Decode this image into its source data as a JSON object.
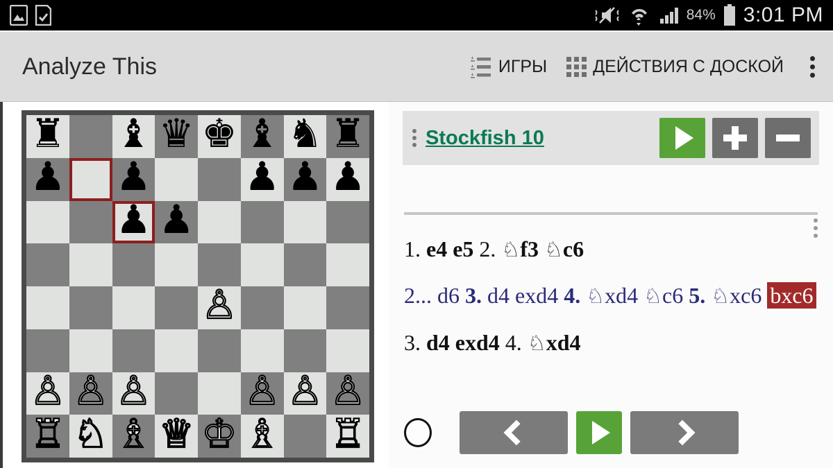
{
  "statusbar": {
    "icons": [
      "gallery-icon",
      "download-complete-icon",
      "mute-vibrate-icon",
      "wifi-icon",
      "cellular-signal-icon"
    ],
    "battery_percent": "84%",
    "battery_icon": "battery-icon",
    "clock": "3:01 PM"
  },
  "appbar": {
    "title": "Analyze This",
    "actions": [
      {
        "icon": "games-list-icon",
        "label": "ИГРЫ"
      },
      {
        "icon": "board-actions-grid-icon",
        "label": "ДЕЙСТВИЯ С ДОСКОЙ"
      }
    ],
    "overflow": "more-options-icon"
  },
  "engine": {
    "name": "Stockfish 10",
    "drag_handle": "drag-handle-icon",
    "buttons": [
      {
        "name": "engine-start-button",
        "icon": "play-icon",
        "color": "#58a338"
      },
      {
        "name": "engine-add-line-button",
        "icon": "plus-icon",
        "color": "#6e6e6e"
      },
      {
        "name": "engine-remove-line-button",
        "icon": "minus-icon",
        "color": "#6e6e6e"
      }
    ]
  },
  "moves": {
    "overflow": "moves-more-options-icon",
    "lines": [
      {
        "type": "main",
        "tokens": [
          {
            "t": "1.",
            "bold": false
          },
          {
            "t": "e4",
            "bold": true
          },
          {
            "t": "e5",
            "bold": true
          },
          {
            "t": "2.",
            "bold": false
          },
          {
            "t": "♘f3",
            "bold": true
          },
          {
            "t": "♘c6",
            "bold": true
          }
        ],
        "text": "1. e4 e5 2. ♘f3 ♘c6"
      },
      {
        "type": "variation",
        "text": "2... d6 3. d4 exd4 4. ♘xd4 ♘c6 5. ♘xc6",
        "highlighted_move": "bxc6"
      },
      {
        "type": "main",
        "tokens": [
          {
            "t": "3.",
            "bold": false
          },
          {
            "t": "d4",
            "bold": true
          },
          {
            "t": "exd4",
            "bold": true
          },
          {
            "t": "4.",
            "bold": false
          },
          {
            "t": "♘xd4",
            "bold": true
          }
        ],
        "text": "3. d4 exd4 4. ♘xd4"
      }
    ]
  },
  "bottom_controls": {
    "toggle": "side-to-move-toggle-white",
    "buttons": [
      {
        "name": "previous-move-button",
        "icon": "chevron-left-icon"
      },
      {
        "name": "auto-play-button",
        "icon": "play-icon"
      },
      {
        "name": "next-move-button",
        "icon": "chevron-right-icon"
      }
    ]
  },
  "board": {
    "light_square_color": "#e0e2e0",
    "dark_square_color": "#808080",
    "highlight_color": "#8c1f1f",
    "highlighted_squares": [
      "b7",
      "c6"
    ],
    "ranks": [
      [
        "♜",
        "",
        "♝",
        "♛",
        "♚",
        "♝",
        "♞",
        "♜"
      ],
      [
        "♟",
        "",
        "♟",
        "",
        "",
        "♟",
        "♟",
        "♟"
      ],
      [
        "",
        "",
        "♟",
        "♟",
        "",
        "",
        "",
        ""
      ],
      [
        "",
        "",
        "",
        "",
        "",
        "",
        "",
        ""
      ],
      [
        "",
        "",
        "",
        "",
        "♙",
        "",
        "",
        ""
      ],
      [
        "",
        "",
        "",
        "",
        "",
        "",
        "",
        ""
      ],
      [
        "♙",
        "♙",
        "♙",
        "",
        "",
        "♙",
        "♙",
        "♙"
      ],
      [
        "♖",
        "♘",
        "♗",
        "♕",
        "♔",
        "♗",
        "",
        "♖"
      ]
    ]
  }
}
